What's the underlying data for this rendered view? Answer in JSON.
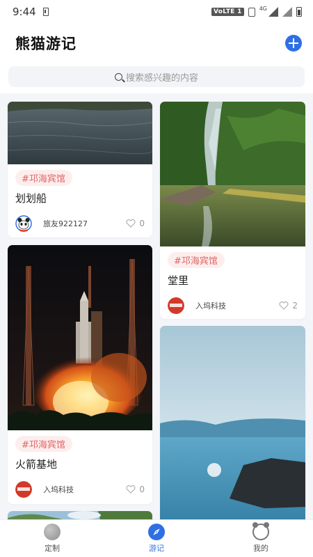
{
  "status": {
    "time": "9:44",
    "volte": "VoLTE 1",
    "network": "4G"
  },
  "header": {
    "title": "熊猫游记"
  },
  "search": {
    "placeholder": "搜索感兴趣的内容"
  },
  "cards": [
    {
      "tag": "#邛海宾馆",
      "title": "划划船",
      "author": "旅友922127",
      "likes": "0"
    },
    {
      "tag": "#邛海宾馆",
      "title": "堂里",
      "author": "入坞科技",
      "likes": "2"
    },
    {
      "tag": "#邛海宾馆",
      "title": "火箭基地",
      "author": "入坞科技",
      "likes": "0"
    }
  ],
  "tabs": [
    {
      "label": "定制"
    },
    {
      "label": "游记"
    },
    {
      "label": "我的"
    }
  ],
  "colors": {
    "accent": "#2f6fe4",
    "tag_bg": "#fdeeee",
    "tag_text": "#e06666"
  }
}
